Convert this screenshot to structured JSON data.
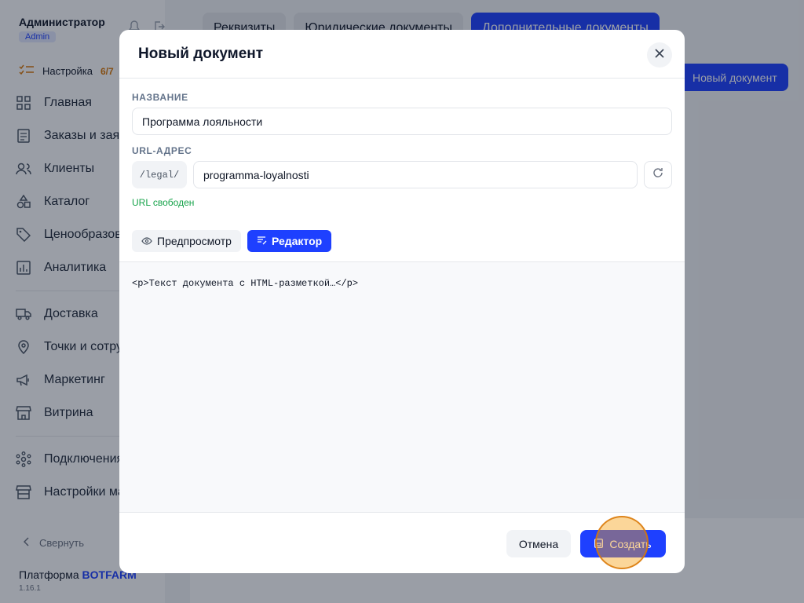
{
  "sidebar": {
    "user_name": "Администратор",
    "role": "Admin",
    "setup_label": "Настройка",
    "setup_progress": "6/7",
    "items_top": [
      {
        "label": "Главная",
        "icon": "grid-icon"
      },
      {
        "label": "Заказы и заявки",
        "icon": "receipt-icon"
      },
      {
        "label": "Клиенты",
        "icon": "users-icon"
      },
      {
        "label": "Каталог",
        "icon": "shapes-icon"
      },
      {
        "label": "Ценообразование",
        "icon": "tag-icon"
      },
      {
        "label": "Аналитика",
        "icon": "chart-icon"
      }
    ],
    "items_mid": [
      {
        "label": "Доставка",
        "icon": "truck-icon"
      },
      {
        "label": "Точки и сотрудники",
        "icon": "pin-icon"
      },
      {
        "label": "Маркетинг",
        "icon": "megaphone-icon"
      },
      {
        "label": "Витрина",
        "icon": "store-icon"
      }
    ],
    "items_bottom": [
      {
        "label": "Подключения",
        "icon": "network-icon"
      },
      {
        "label": "Настройки магазина",
        "icon": "store-settings-icon"
      }
    ],
    "collapse_label": "Свернуть",
    "platform_label": "Платформа ",
    "platform_brand": "BOTFARM",
    "version": "1.16.1"
  },
  "main": {
    "tabs": [
      {
        "label": "Реквизиты"
      },
      {
        "label": "Юридические документы"
      },
      {
        "label": "Дополнительные документы"
      }
    ],
    "new_document_button": "Новый документ"
  },
  "modal": {
    "title": "Новый документ",
    "name_label": "НАЗВАНИЕ",
    "name_value": "Программа лояльности",
    "url_label": "URL-АДРЕС",
    "url_prefix": "/legal/",
    "url_value": "programma-loyalnosti",
    "url_status": "URL свободен",
    "preview_label": "Предпросмотр",
    "editor_label": "Редактор",
    "editor_content": "<p>Текст документа с HTML-разметкой…</p>",
    "cancel_label": "Отмена",
    "create_label": "Создать"
  },
  "colors": {
    "accent": "#1e40ff",
    "success": "#16a34a",
    "warning": "#d97706"
  }
}
